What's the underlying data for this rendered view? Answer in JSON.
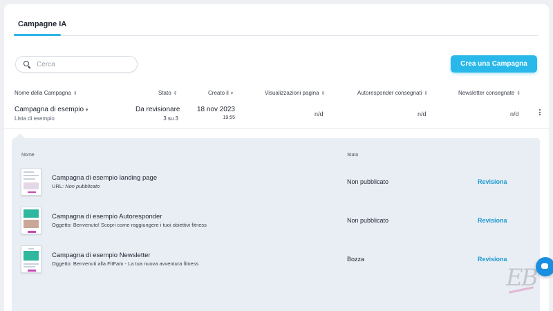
{
  "tabs": [
    {
      "label": "Campagne IA",
      "active": true
    }
  ],
  "search": {
    "placeholder": "Cerca",
    "value": ""
  },
  "create_button": {
    "label": "Crea una Campagna"
  },
  "columns": {
    "name": "Nome della Campagna",
    "status": "Stato",
    "created": "Creato il",
    "views": "Visualizzazioni pagina",
    "autoresponder": "Autoresponder consegnati",
    "newsletter": "Newsletter consegnate"
  },
  "campaign": {
    "name": "Campagna di esempio",
    "list": "Lista di esempio",
    "status": "Da revisionare",
    "status_progress": "3 su 3",
    "created_date": "18 nov 2023",
    "created_time": "19:55",
    "views": "n/d",
    "autoresponder": "n/d",
    "newsletter": "n/d"
  },
  "sub_table": {
    "col_name": "Nome",
    "col_status": "Stato",
    "items": [
      {
        "title": "Campagna di esempio landing page",
        "sub_label": "URL:",
        "sub_value": "Non pubblicato",
        "status": "Non pubblicato",
        "action": "Revisiona"
      },
      {
        "title": "Campagna di esempio Autoresponder",
        "sub_label": "Oggetto:",
        "sub_value": "Benvenuto! Scopri come raggiungere i tuoi obiettivi fitness",
        "status": "Non pubblicato",
        "action": "Revisiona"
      },
      {
        "title": "Campagna di esempio Newsletter",
        "sub_label": "Oggetto:",
        "sub_value": "Benvenuti alla FitFam - La tua nuova avventura fitness",
        "status": "Bozza",
        "action": "Revisiona"
      }
    ]
  },
  "icons": {
    "search": "search-icon",
    "sort": "sort-icon",
    "chevron": "chevron-down-icon",
    "more": "kebab-menu-icon",
    "chat": "chat-icon"
  },
  "colors": {
    "accent": "#28b8ea",
    "link": "#1e9ad2",
    "sub_panel": "#e9edf4",
    "chat": "#1a8fe0"
  },
  "watermark": "EB"
}
